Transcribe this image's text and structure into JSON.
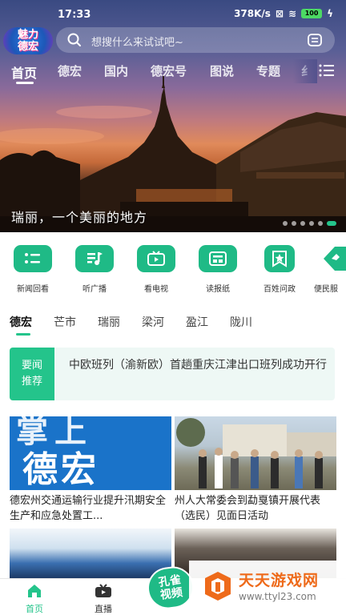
{
  "status_bar": {
    "time": "17:33",
    "network_speed": "378K/s",
    "battery": "100"
  },
  "header": {
    "logo_text_line1": "魅力",
    "logo_text_line2": "德宏",
    "search_placeholder": "想搜什么来试试吧~"
  },
  "tabs": [
    {
      "label": "首页",
      "active": true
    },
    {
      "label": "德宏",
      "active": false
    },
    {
      "label": "国内",
      "active": false
    },
    {
      "label": "德宏号",
      "active": false
    },
    {
      "label": "图说",
      "active": false
    },
    {
      "label": "专题",
      "active": false
    },
    {
      "label": "纟",
      "active": false
    }
  ],
  "hero": {
    "caption": "瑞丽，一个美丽的地方",
    "slide_count": 6,
    "active_slide": 6
  },
  "quick_entries": [
    {
      "label": "新闻回看",
      "icon": "news-list-icon"
    },
    {
      "label": "听广播",
      "icon": "music-icon"
    },
    {
      "label": "看电视",
      "icon": "tv-icon"
    },
    {
      "label": "读报纸",
      "icon": "newspaper-icon"
    },
    {
      "label": "百姓问政",
      "icon": "star-bookmark-icon"
    },
    {
      "label": "便民服",
      "icon": "service-icon"
    }
  ],
  "regions": [
    {
      "label": "德宏",
      "active": true
    },
    {
      "label": "芒市",
      "active": false
    },
    {
      "label": "瑞丽",
      "active": false
    },
    {
      "label": "梁河",
      "active": false
    },
    {
      "label": "盈江",
      "active": false
    },
    {
      "label": "陇川",
      "active": false
    }
  ],
  "recommend": {
    "tag_line1": "要闻",
    "tag_line2": "推荐",
    "headline": "中欧班列（渝新欧）首趟重庆江津出口班列成功开行"
  },
  "news_cards": [
    {
      "title": "德宏州交通运输行业提升汛期安全生产和应急处置工...",
      "image_text": "德宏",
      "image_text_top": "掌上"
    },
    {
      "title": "州人大常委会到勐戛镇开展代表（选民）见面日活动"
    },
    {
      "title": ""
    },
    {
      "title": ""
    }
  ],
  "float_badge": {
    "line1": "孔雀",
    "line2": "视频"
  },
  "bottom_nav": [
    {
      "label": "首页",
      "icon": "home-icon",
      "active": true
    },
    {
      "label": "直播",
      "icon": "live-tv-icon",
      "active": false
    }
  ],
  "watermark": {
    "title": "天天游戏网",
    "url": "www.ttyl23.com"
  },
  "colors": {
    "accent": "#24c48b",
    "icon_bg": "#1fba86",
    "recommend_bg": "#eef8f5",
    "watermark": "#ee6a1a"
  }
}
